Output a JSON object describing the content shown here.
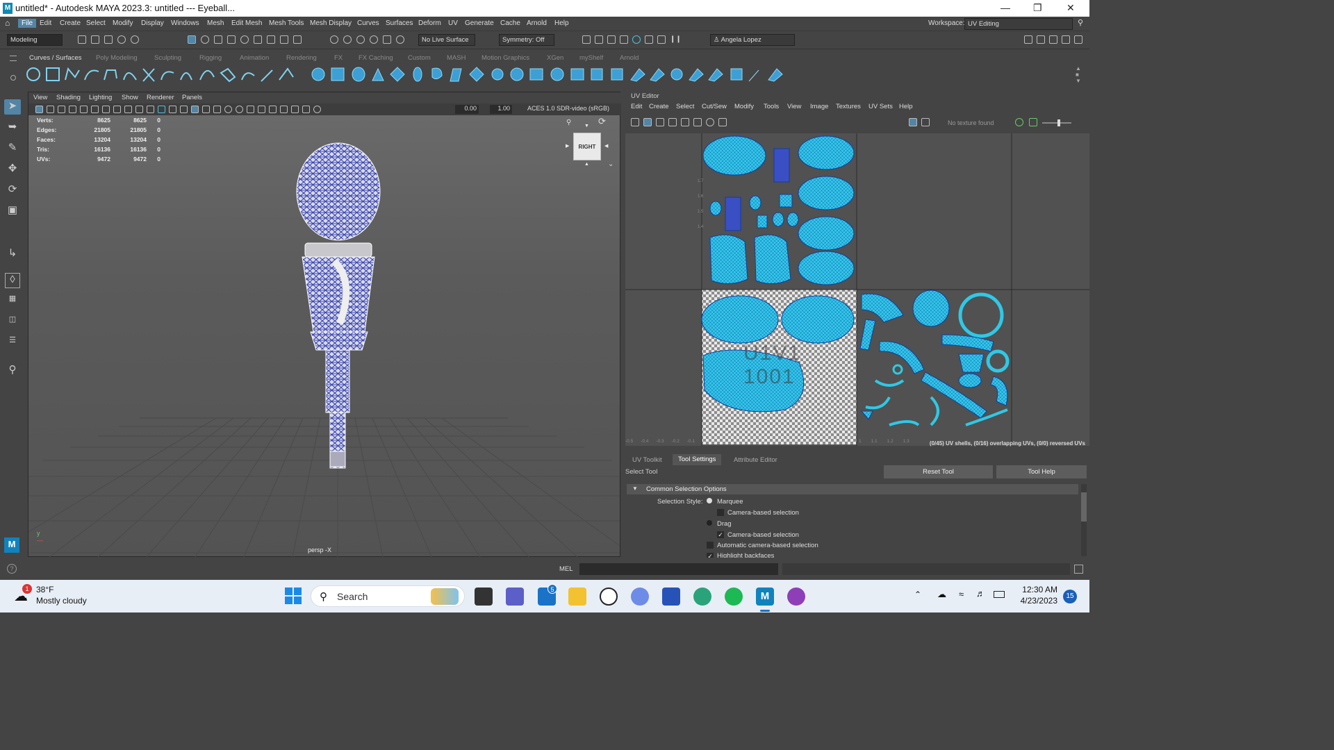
{
  "titlebar": {
    "title": "untitled* - Autodesk MAYA 2023.3: untitled   ---   Eyeball...",
    "logo": "M"
  },
  "menus": [
    "File",
    "Edit",
    "Create",
    "Select",
    "Modify",
    "Display",
    "Windows",
    "Mesh",
    "Edit Mesh",
    "Mesh Tools",
    "Mesh Display",
    "Curves",
    "Surfaces",
    "Deform",
    "UV",
    "Generate",
    "Cache",
    "Arnold",
    "Help"
  ],
  "workspace": {
    "label": "Workspace:",
    "value": "UV Editing"
  },
  "status": {
    "mode": "Modeling",
    "live_surface": "No Live Surface",
    "symmetry": "Symmetry: Off",
    "user": "Angela Lopez"
  },
  "shelf_tabs": [
    "Curves / Surfaces",
    "Poly Modeling",
    "Sculpting",
    "Rigging",
    "Animation",
    "Rendering",
    "FX",
    "FX Caching",
    "Custom",
    "MASH",
    "Motion Graphics",
    "XGen",
    "myShelf",
    "Arnold"
  ],
  "viewport": {
    "menus": [
      "View",
      "Shading",
      "Lighting",
      "Show",
      "Renderer",
      "Panels"
    ],
    "exposure": "0.00",
    "gamma": "1.00",
    "colorspace": "ACES 1.0 SDR-video (sRGB)",
    "hud": {
      "rows": [
        {
          "label": "Verts:",
          "a": "8625",
          "b": "8625",
          "c": "0"
        },
        {
          "label": "Edges:",
          "a": "21805",
          "b": "21805",
          "c": "0"
        },
        {
          "label": "Faces:",
          "a": "13204",
          "b": "13204",
          "c": "0"
        },
        {
          "label": "Tris:",
          "a": "16136",
          "b": "16136",
          "c": "0"
        },
        {
          "label": "UVs:",
          "a": "9472",
          "b": "9472",
          "c": "0"
        }
      ]
    },
    "viewcube": "RIGHT",
    "camera": "persp -X"
  },
  "uv_editor": {
    "title": "UV Editor",
    "menus": [
      "Edit",
      "Create",
      "Select",
      "Cut/Sew",
      "Modify",
      "Tools",
      "View",
      "Image",
      "Textures",
      "UV Sets",
      "Help"
    ],
    "texture": "No texture found",
    "status": "(0/45) UV shells, (0/16) overlapping UVs, (0/0) reversed UVs",
    "tile_label": "U1V1",
    "tile_num": "1001",
    "axis_left": [
      "-0.5",
      "-0.4",
      "-0.3",
      "-0.2",
      "-0.1"
    ],
    "axis_right": [
      "1",
      "1.1",
      "1.2",
      "1.3"
    ],
    "v_ticks": [
      "1.7",
      "1.6",
      "1.5",
      "1.4"
    ]
  },
  "tool_settings": {
    "tabs": [
      "UV Toolkit",
      "Tool Settings",
      "Attribute Editor"
    ],
    "tool": "Select Tool",
    "reset": "Reset Tool",
    "help": "Tool Help",
    "section": "Common Selection Options",
    "style_label": "Selection Style:",
    "marquee": "Marquee",
    "camera_based": "Camera-based selection",
    "drag": "Drag",
    "camera_based2": "Camera-based selection",
    "auto_camera": "Automatic camera-based selection",
    "highlight": "Highlight backfaces"
  },
  "cmdline": {
    "lang": "MEL"
  },
  "taskbar": {
    "temp": "38°F",
    "weather": "Mostly cloudy",
    "weather_badge": "1",
    "search": "Search",
    "mail_badge": "5",
    "time": "12:30 AM",
    "date": "4/23/2023",
    "notif": "15"
  },
  "colors": {
    "accent": "#5285a6",
    "uv_cyan": "#2ec9e6",
    "uv_blue": "#3b4fc4",
    "wire": "#3a45b5"
  }
}
